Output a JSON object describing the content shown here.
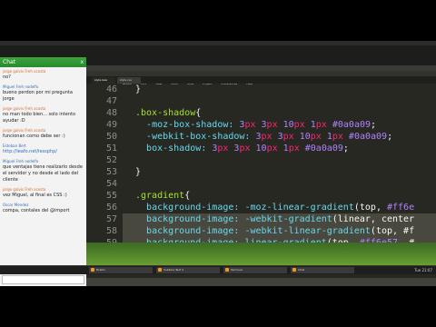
{
  "chat": {
    "title": "Chat",
    "close_label": "x",
    "messages": [
      {
        "sender": "jorge galvis Freh acosta",
        "text": "no?"
      },
      {
        "sender": "Miguel Freh nodelfo",
        "text": "bueno perdon por mi pregunta jorge"
      },
      {
        "sender": "jorge galvis Freh acosta",
        "text": "no man todo bien... solo intento ayudar :D"
      },
      {
        "sender": "jorge galvis Freh acosta",
        "text": "funcionan como debe ser :)"
      },
      {
        "sender": "Esteban Bert",
        "text": "http://leafo.net/lessphp/"
      },
      {
        "sender": "Miguel Freh nodelfo",
        "text": "que ventajas tiene realizarlo desde el servidor y no desde el lado del cliente"
      },
      {
        "sender": "jorge galvis Freh acosta",
        "text": "vez Miguel, al final es CSS :)"
      },
      {
        "sender": "Oscar Mendez",
        "text": "compa, contales del @import"
      }
    ]
  },
  "editor": {
    "menu": [
      "File",
      "Edit",
      "Selection",
      "Find",
      "View",
      "Goto",
      "Tools",
      "Project",
      "Preferences",
      "Help"
    ],
    "tabs": [
      "style.less",
      "style.css"
    ]
  },
  "code": {
    "line_numbers": [
      "46",
      "47",
      "48",
      "49",
      "50",
      "51",
      "52",
      "53",
      "54",
      "55",
      "56",
      "57",
      "58",
      "59"
    ],
    "line46": "}",
    "l48_sel": ".box-shadow",
    "l48_brace": "{",
    "l49_prop": "-moz-box-shadow:",
    "l50_prop": "-webkit-box-shadow:",
    "l51_prop": "box-shadow:",
    "shadow_v1": "3",
    "shadow_v2": "3",
    "shadow_v3": "10",
    "shadow_v4": "1",
    "px": "px",
    "hex_shadow": "#0a0a09",
    "semicolon": ";",
    "l53_close": "}",
    "l55_sel": ".gradient",
    "l55_brace": "{",
    "bg_prop": "background-image:",
    "l56_fn": "-moz-linear-gradient",
    "l56_args": "(top, ",
    "l56_hex": "#ff6e",
    "l57_fn": "-webkit-gradient",
    "l57_args": "(linear, center",
    "l58_fn": "-webkit-linear-gradient",
    "l58_args": "(top, #f",
    "l59_fn": "linear-gradient",
    "l59_args": "(top, ",
    "l59_hex": "#ff6e57",
    "l59_tail": ", #"
  },
  "taskbar": {
    "tasks": [
      "Firefox",
      "Sublime Text 2",
      "Terminal",
      "Chat"
    ],
    "clock": "Tue 21:07"
  },
  "colors": {
    "chat_header": "#2a8a2e",
    "editor_bg": "#272822",
    "selector": "#a6e22e",
    "property": "#66d9ef",
    "number": "#ae81ff",
    "unit": "#f92672"
  }
}
